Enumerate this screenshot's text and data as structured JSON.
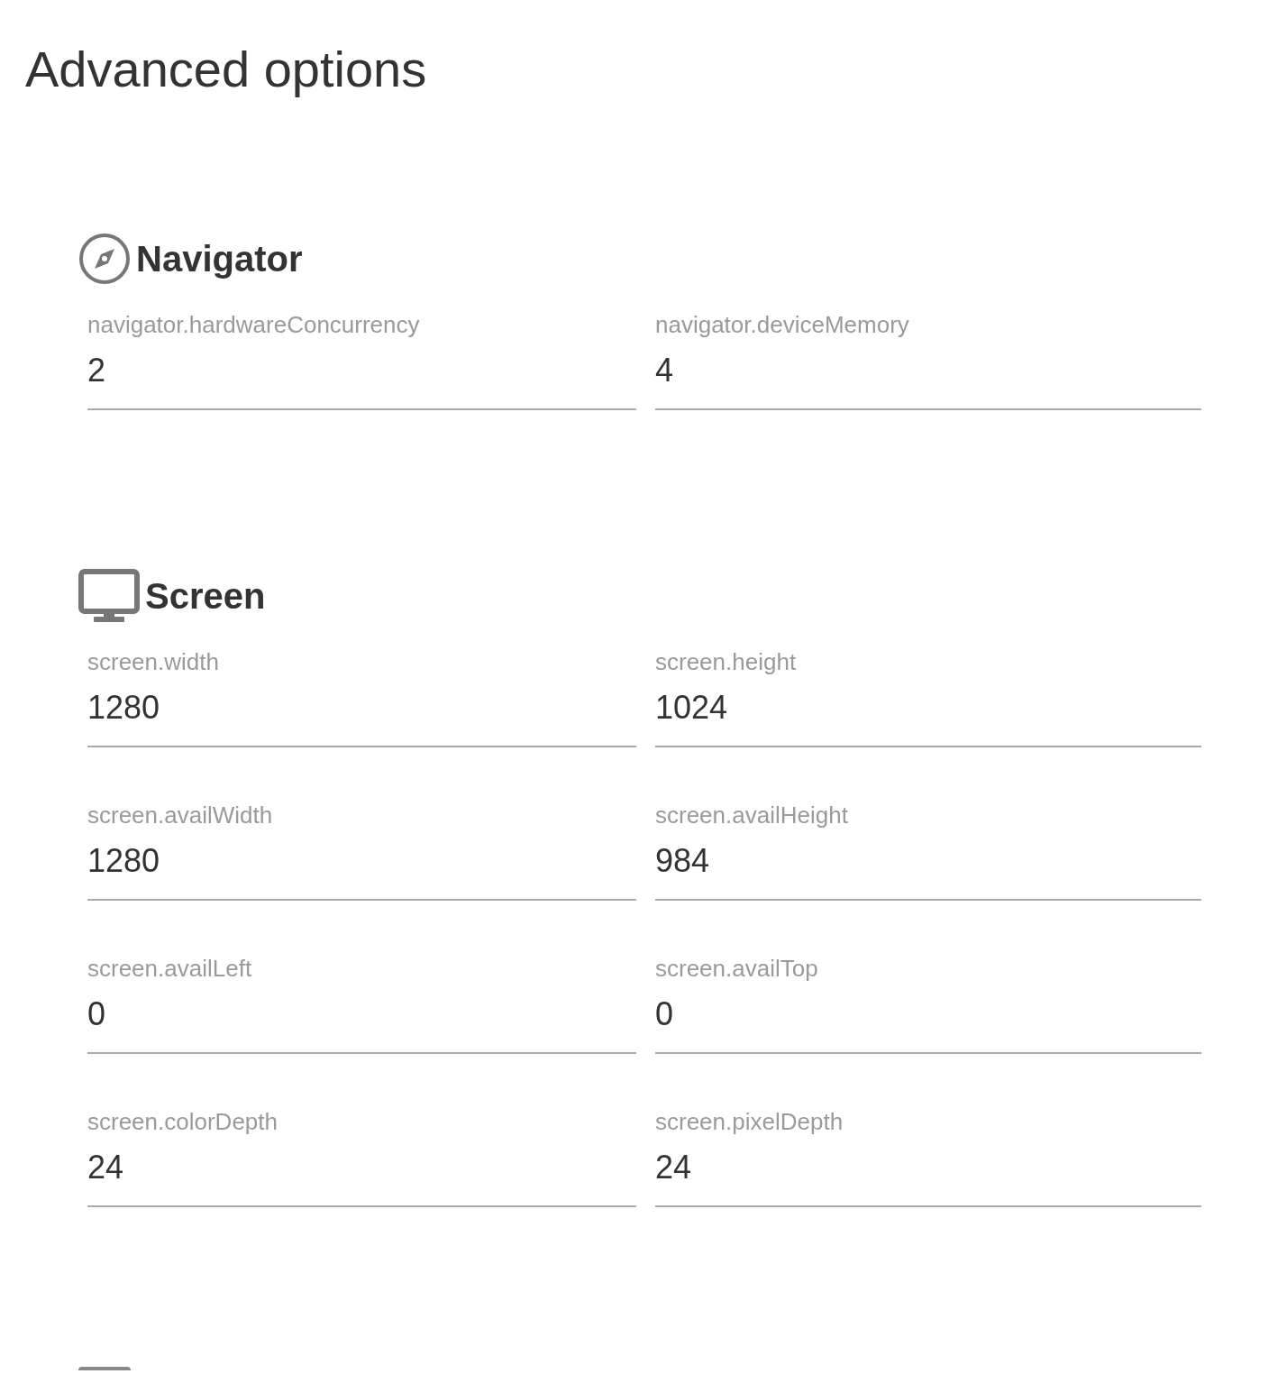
{
  "title": "Advanced options",
  "sections": [
    {
      "kind": "compass",
      "title": "Navigator",
      "fields": [
        {
          "label": "navigator.hardwareConcurrency",
          "value": "2"
        },
        {
          "label": "navigator.deviceMemory",
          "value": "4"
        }
      ]
    },
    {
      "kind": "monitor",
      "title": "Screen",
      "fields": [
        {
          "label": "screen.width",
          "value": "1280"
        },
        {
          "label": "screen.height",
          "value": "1024"
        },
        {
          "label": "screen.availWidth",
          "value": "1280"
        },
        {
          "label": "screen.availHeight",
          "value": "984"
        },
        {
          "label": "screen.availLeft",
          "value": "0"
        },
        {
          "label": "screen.availTop",
          "value": "0"
        },
        {
          "label": "screen.colorDepth",
          "value": "24"
        },
        {
          "label": "screen.pixelDepth",
          "value": "24"
        }
      ]
    },
    {
      "kind": "partial"
    }
  ]
}
